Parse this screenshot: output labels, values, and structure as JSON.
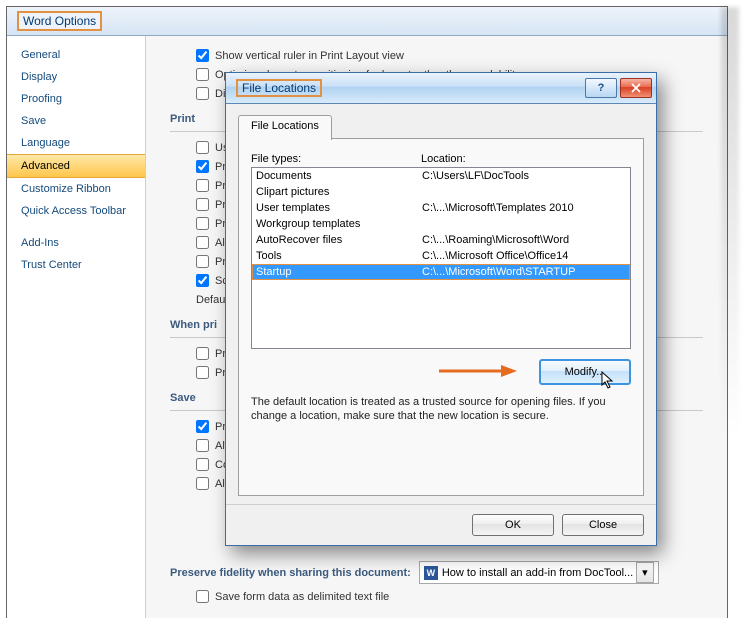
{
  "window": {
    "title": "Word Options",
    "nav": [
      {
        "label": "General"
      },
      {
        "label": "Display"
      },
      {
        "label": "Proofing"
      },
      {
        "label": "Save"
      },
      {
        "label": "Language"
      },
      {
        "label": "Advanced",
        "selected": true
      },
      {
        "label": "Customize Ribbon"
      },
      {
        "label": "Quick Access Toolbar"
      },
      {
        "label": "Add-Ins"
      },
      {
        "label": "Trust Center"
      }
    ],
    "options_top": [
      {
        "checked": true,
        "label": "Show vertical ruler in Print Layout view"
      },
      {
        "checked": false,
        "label": "Optimize character positioning for layout rather than readability"
      },
      {
        "checked": false,
        "label": "Disa"
      }
    ],
    "group_print": {
      "title": "Print",
      "items": [
        {
          "checked": false,
          "label": "Use"
        },
        {
          "checked": true,
          "label": "Print"
        },
        {
          "checked": false,
          "label": "Print"
        },
        {
          "checked": false,
          "label": "Print"
        },
        {
          "checked": false,
          "label": "Print"
        },
        {
          "checked": false,
          "label": "Allow"
        },
        {
          "checked": false,
          "label": "Print"
        },
        {
          "checked": true,
          "label": "Scale"
        }
      ],
      "default_label": "Default t"
    },
    "group_when_print": {
      "title": "When pri",
      "items": [
        {
          "checked": false,
          "label": "Print"
        },
        {
          "checked": false,
          "label": "Print"
        }
      ]
    },
    "group_save": {
      "title": "Save",
      "items": [
        {
          "checked": true,
          "label": "Pron"
        },
        {
          "checked": false,
          "label": "Alwa"
        },
        {
          "checked": false,
          "label": "Cop"
        },
        {
          "checked": false,
          "label": "Allow"
        }
      ]
    },
    "fidelity": {
      "label": "Preserve fidelity when sharing this document:",
      "doc": "How to install an add-in from DocTool..."
    },
    "last_row": {
      "checked": false,
      "label": "Save form data as delimited text file"
    }
  },
  "dialog": {
    "title": "File Locations",
    "tab_label": "File Locations",
    "col1": "File types:",
    "col2": "Location:",
    "rows": [
      {
        "type": "Documents",
        "loc": "C:\\Users\\LF\\DocTools"
      },
      {
        "type": "Clipart pictures",
        "loc": ""
      },
      {
        "type": "User templates",
        "loc": "C:\\...\\Microsoft\\Templates 2010"
      },
      {
        "type": "Workgroup templates",
        "loc": ""
      },
      {
        "type": "AutoRecover files",
        "loc": "C:\\...\\Roaming\\Microsoft\\Word"
      },
      {
        "type": "Tools",
        "loc": "C:\\...\\Microsoft Office\\Office14"
      },
      {
        "type": "Startup",
        "loc": "C:\\...\\Microsoft\\Word\\STARTUP",
        "selected": true
      }
    ],
    "modify_label": "Modify...",
    "info": "The default location is treated as a trusted source for opening files. If you change a location, make sure that the new location is secure.",
    "ok_label": "OK",
    "close_label": "Close"
  }
}
